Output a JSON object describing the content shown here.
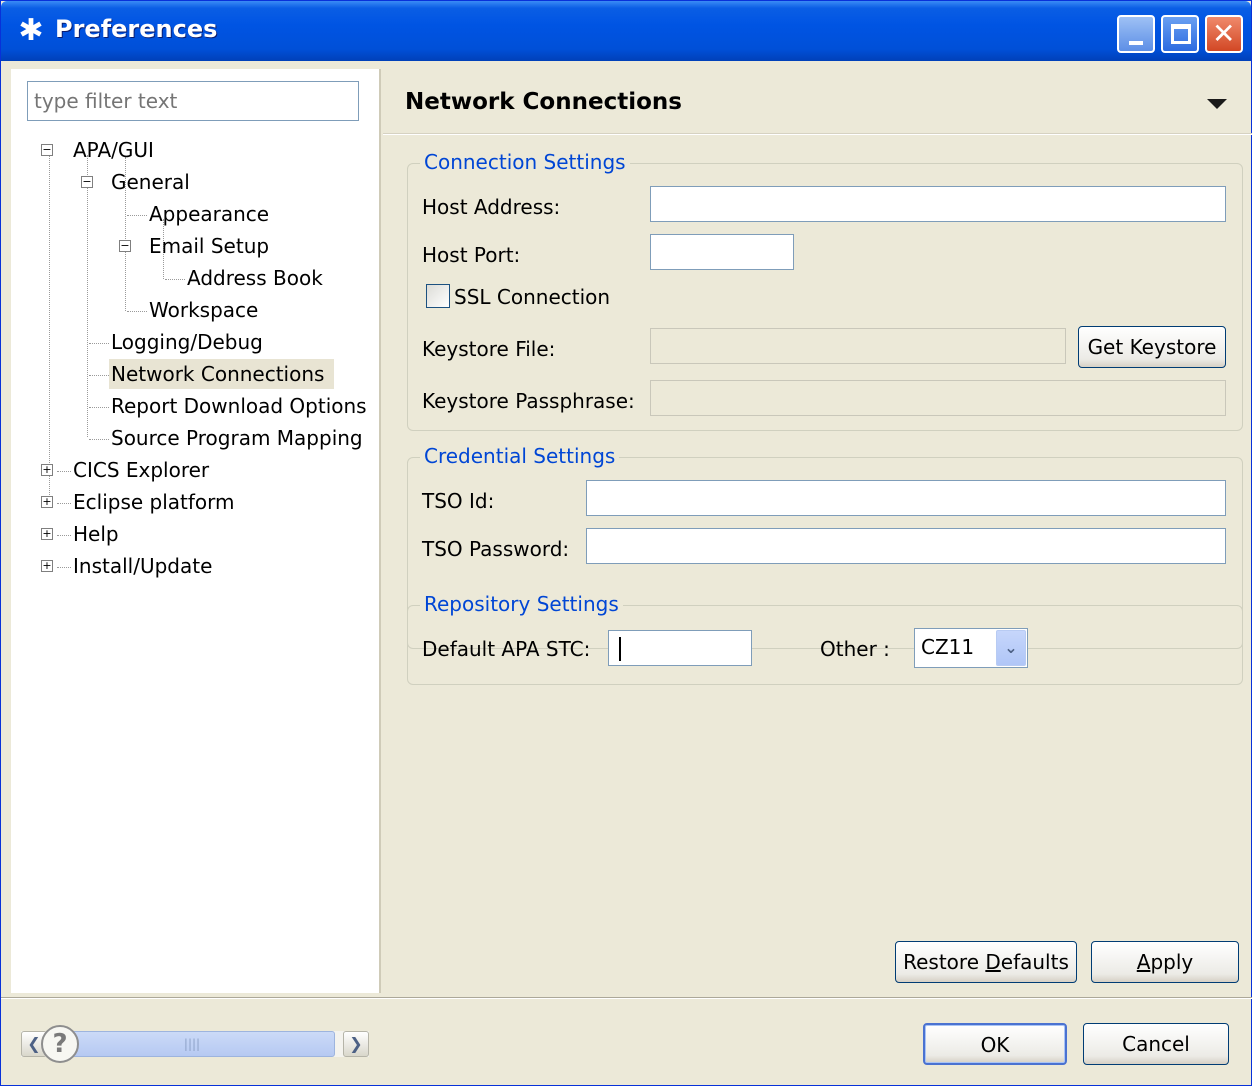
{
  "window": {
    "title": "Preferences"
  },
  "filter": {
    "placeholder": "type filter text"
  },
  "tree": {
    "apa_gui": "APA/GUI",
    "general": "General",
    "appearance": "Appearance",
    "email_setup": "Email Setup",
    "address_book": "Address Book",
    "workspace": "Workspace",
    "logging_debug": "Logging/Debug",
    "network_connections": "Network Connections",
    "report_download_options": "Report Download Options",
    "source_program_mapping": "Source Program Mapping",
    "cics_explorer": "CICS Explorer",
    "eclipse_platform": "Eclipse platform",
    "help": "Help",
    "install_update": "Install/Update",
    "selected": "Network Connections"
  },
  "page": {
    "title": "Network Connections"
  },
  "connection": {
    "group_title": "Connection Settings",
    "host_address_label": "Host Address:",
    "host_address_value": "",
    "host_port_label": "Host Port:",
    "host_port_value": "",
    "ssl_label": "SSL Connection",
    "ssl_checked": false,
    "keystore_file_label": "Keystore File:",
    "keystore_file_value": "",
    "get_keystore_label": "Get Keystore",
    "keystore_pass_label": "Keystore Passphrase:",
    "keystore_pass_value": ""
  },
  "credential": {
    "group_title": "Credential Settings",
    "tso_id_label": "TSO Id:",
    "tso_id_value": "",
    "tso_password_label": "TSO Password:",
    "tso_password_value": ""
  },
  "repository": {
    "group_title": "Repository Settings",
    "default_stc_label": "Default APA STC:",
    "default_stc_value": "",
    "other_label": "Other :",
    "other_selected": "CZ11"
  },
  "buttons": {
    "restore_defaults_pre": "Restore ",
    "restore_defaults_mnemonic": "D",
    "restore_defaults_post": "efaults",
    "apply_mnemonic": "A",
    "apply_post": "pply",
    "ok": "OK",
    "cancel": "Cancel"
  },
  "icons": {
    "app": "preferences-gear-icon",
    "help": "help-icon",
    "minimize": "minimize-icon",
    "maximize": "maximize-icon",
    "close": "close-icon"
  },
  "colors": {
    "titlebar": "#0054e3",
    "group_title": "#0046d5",
    "dialog_bg": "#ece9d8"
  }
}
